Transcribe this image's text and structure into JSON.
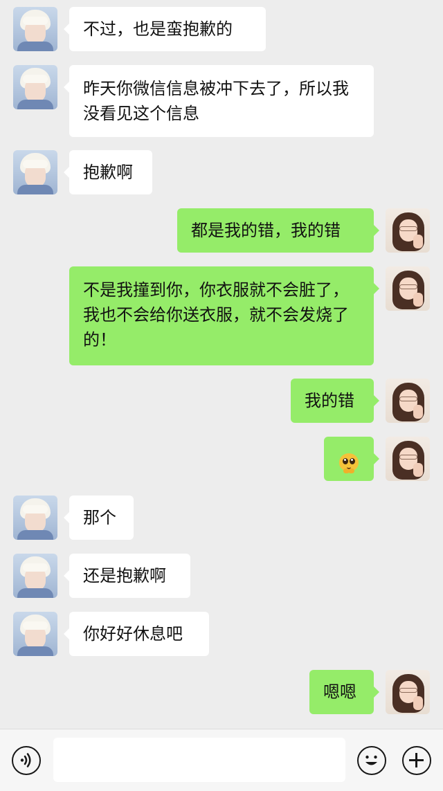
{
  "messages": [
    {
      "side": "left",
      "text": "不过，也是蛮抱歉的"
    },
    {
      "side": "left",
      "text": "昨天你微信信息被冲下去了，所以我没看见这个信息"
    },
    {
      "side": "left",
      "text": "抱歉啊"
    },
    {
      "side": "right",
      "text": "都是我的错，我的错"
    },
    {
      "side": "right",
      "text": "不是我撞到你，你衣服就不会脏了，我也不会给你送衣服，就不会发烧了的！"
    },
    {
      "side": "right",
      "text": "我的错"
    },
    {
      "side": "right",
      "sticker": "pleading-face-emoji"
    },
    {
      "side": "left",
      "text": "那个"
    },
    {
      "side": "left",
      "text": "还是抱歉啊"
    },
    {
      "side": "left",
      "text": "你好好休息吧"
    },
    {
      "side": "right",
      "text": "嗯嗯"
    }
  ],
  "input_bar": {
    "text_value": "",
    "voice_icon": "voice-icon",
    "emoji_icon": "emoji-icon",
    "plus_icon": "plus-icon"
  },
  "colors": {
    "background": "#ededed",
    "sent_bubble": "#95ec69",
    "received_bubble": "#ffffff"
  }
}
